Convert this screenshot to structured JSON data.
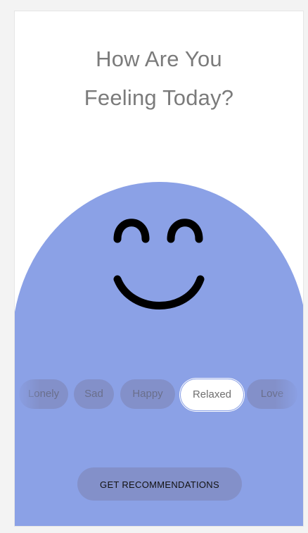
{
  "header": {
    "title_line1": "How Are You",
    "title_line2": "Feeling Today?"
  },
  "mascot": {
    "expression": "smile",
    "eyes": "closed-happy-arc",
    "mouth": "smile",
    "color": "#8ba1e6"
  },
  "moods": {
    "items": [
      "Lonely",
      "Sad",
      "Happy",
      "Relaxed",
      "Love"
    ],
    "selected": "Relaxed"
  },
  "cta": {
    "label": "GET RECOMMENDATIONS"
  },
  "colors": {
    "blob": "#8ba1e6",
    "chip": "#8390c9",
    "title": "#7b7b7b",
    "selected_chip": "#ffffff"
  }
}
